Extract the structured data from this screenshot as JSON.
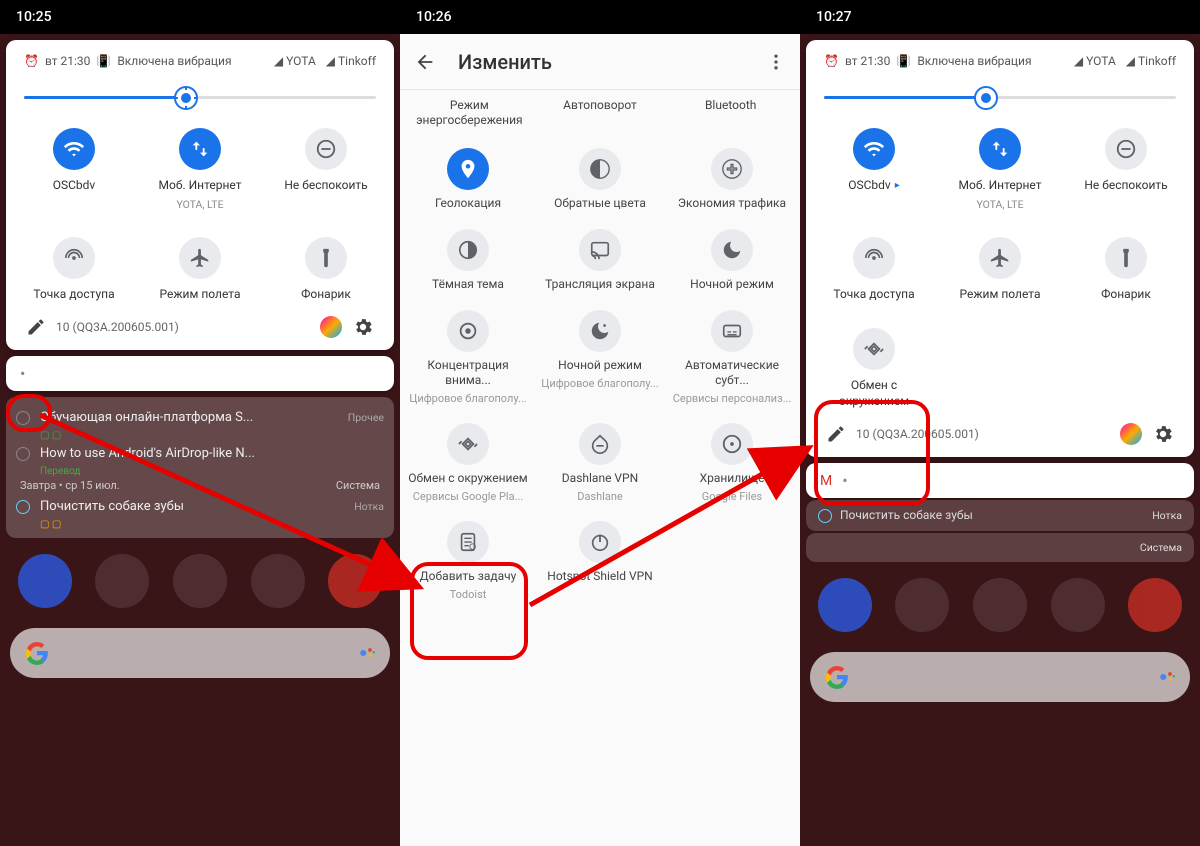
{
  "screens": {
    "left": {
      "time": "10:25",
      "status": {
        "alarm": "вт 21:30",
        "vibration": "Включена вибрация",
        "carriers": [
          "YOTA",
          "Tinkoff"
        ]
      },
      "build": "10 (QQ3A.200605.001)",
      "tiles": [
        {
          "label": "OSCbdv",
          "sub": "",
          "icon": "wifi",
          "on": true
        },
        {
          "label": "Моб. Интернет",
          "sub": "YOTA, LTE",
          "icon": "data",
          "on": true
        },
        {
          "label": "Не беспокоить",
          "sub": "",
          "icon": "dnd",
          "on": false
        },
        {
          "label": "Точка доступа",
          "sub": "",
          "icon": "hotspot",
          "on": false
        },
        {
          "label": "Режим полета",
          "sub": "",
          "icon": "airplane",
          "on": false
        },
        {
          "label": "Фонарик",
          "sub": "",
          "icon": "torch",
          "on": false
        }
      ],
      "notifs": {
        "row1": "Обучающая онлайн-платформа S...",
        "row1_src": "Прочее",
        "row2": "How to use Android's AirDrop-like N...",
        "row2_src": "Перевод",
        "date": "Завтра • ср 15 июл.",
        "row3": "Почистить собаке зубы",
        "row3_src": "Нотка",
        "sys": "Система"
      }
    },
    "mid": {
      "time": "10:26",
      "title": "Изменить",
      "top_labels": [
        "Режим энергосбережения",
        "Автоповорот",
        "Bluetooth"
      ],
      "tiles": [
        {
          "label": "Геолокация",
          "icon": "location",
          "on": true
        },
        {
          "label": "Обратные цвета",
          "icon": "invert"
        },
        {
          "label": "Экономия трафика",
          "icon": "datasaver"
        },
        {
          "label": "Тёмная тема",
          "icon": "dark"
        },
        {
          "label": "Трансляция экрана",
          "icon": "cast"
        },
        {
          "label": "Ночной режим",
          "icon": "night"
        },
        {
          "label": "Концентрация внима...",
          "sub": "Цифровое благополу...",
          "icon": "focus"
        },
        {
          "label": "Ночной режим",
          "sub": "Цифровое благополу...",
          "icon": "night2"
        },
        {
          "label": "Автоматические субт...",
          "sub": "Сервисы персонализ...",
          "icon": "caption"
        },
        {
          "label": "Обмен с окружением",
          "sub": "Сервисы Google Pla...",
          "icon": "nearby"
        },
        {
          "label": "Dashlane VPN",
          "sub": "Dashlane",
          "icon": "vpn"
        },
        {
          "label": "Хранилище",
          "sub": "Google Files",
          "icon": "storage"
        },
        {
          "label": "Добавить задачу",
          "sub": "Todoist",
          "icon": "task"
        },
        {
          "label": "Hotspot Shield VPN",
          "icon": "power"
        }
      ]
    },
    "right": {
      "time": "10:27",
      "status": {
        "alarm": "вт 21:30",
        "vibration": "Включена вибрация",
        "carriers": [
          "YOTA",
          "Tinkoff"
        ]
      },
      "build": "10 (QQ3A.200605.001)",
      "tiles": [
        {
          "label": "OSCbdv",
          "sub": "",
          "icon": "wifi",
          "on": true,
          "caret": true
        },
        {
          "label": "Моб. Интернет",
          "sub": "YOTA, LTE",
          "icon": "data",
          "on": true
        },
        {
          "label": "Не беспокоить",
          "sub": "",
          "icon": "dnd",
          "on": false
        },
        {
          "label": "Точка доступа",
          "sub": "",
          "icon": "hotspot",
          "on": false
        },
        {
          "label": "Режим полета",
          "sub": "",
          "icon": "airplane",
          "on": false
        },
        {
          "label": "Фонарик",
          "sub": "",
          "icon": "torch",
          "on": false
        },
        {
          "label": "Обмен с окружением",
          "sub": "",
          "icon": "nearby",
          "on": false
        }
      ],
      "bg_notif": {
        "title": "Почистить собаке зубы",
        "src": "Нотка",
        "sys": "Система"
      }
    }
  }
}
